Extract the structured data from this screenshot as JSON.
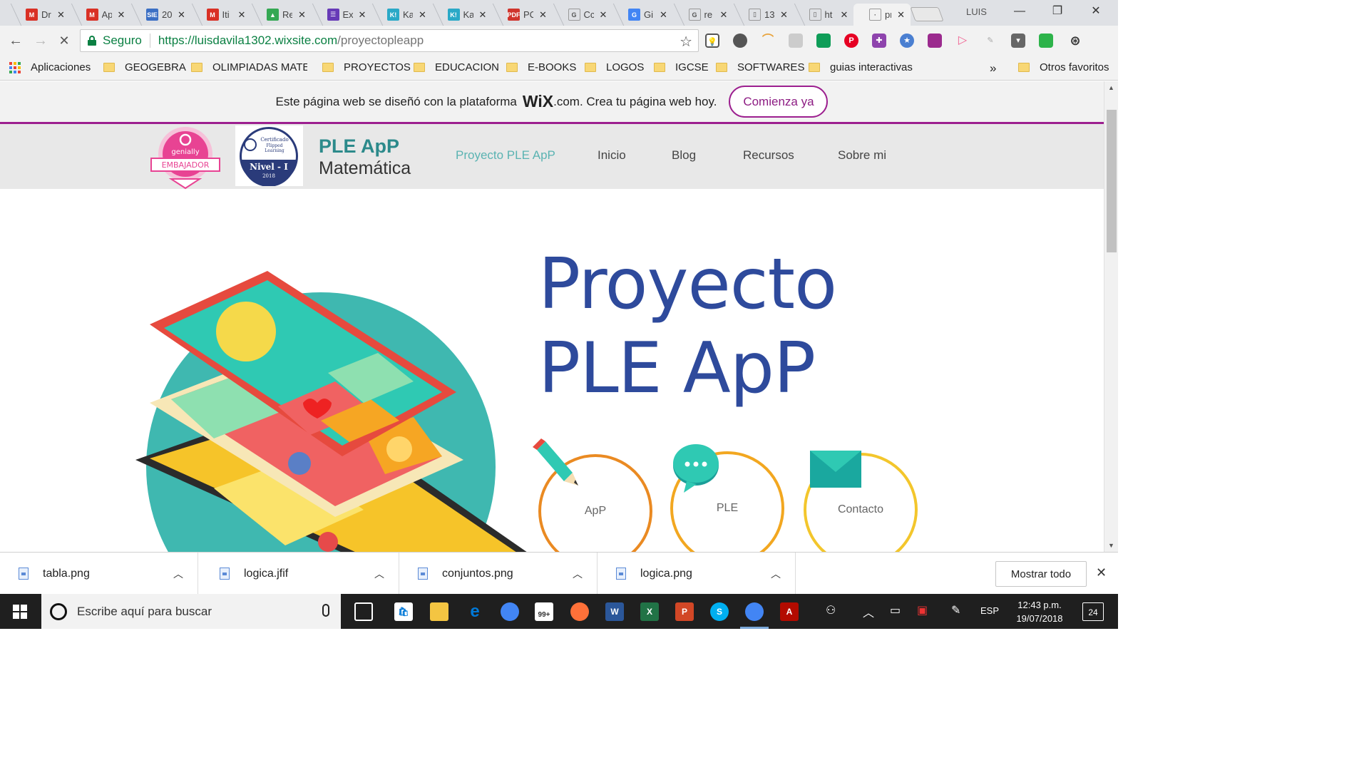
{
  "browser": {
    "tabs": [
      {
        "title": "Dr",
        "icon": "gmail-icon",
        "color": "#d93025",
        "glyph": "M"
      },
      {
        "title": "Ap",
        "icon": "gmail-icon",
        "color": "#d93025",
        "glyph": "M"
      },
      {
        "title": "20",
        "icon": "sie-icon",
        "color": "#3b6fc4",
        "glyph": "SIE"
      },
      {
        "title": "Iti",
        "icon": "gmail-icon",
        "color": "#d93025",
        "glyph": "M"
      },
      {
        "title": "Re",
        "icon": "drive-icon",
        "color": "#34a853",
        "glyph": "▲"
      },
      {
        "title": "Ex",
        "icon": "forms-icon",
        "color": "#673ab7",
        "glyph": "☰"
      },
      {
        "title": "Ka",
        "icon": "kahoot-icon",
        "color": "#2aa9c7",
        "glyph": "K!"
      },
      {
        "title": "Ka",
        "icon": "kahoot-icon",
        "color": "#2aa9c7",
        "glyph": "K!"
      },
      {
        "title": "PC",
        "icon": "pdf-icon",
        "color": "#d0342c",
        "glyph": "PDF"
      },
      {
        "title": "Cc",
        "icon": "google-icon",
        "color": "#ffffff",
        "glyph": "G"
      },
      {
        "title": "Gi",
        "icon": "translate-icon",
        "color": "#4285f4",
        "glyph": "G"
      },
      {
        "title": "re",
        "icon": "google-icon",
        "color": "#ffffff",
        "glyph": "G"
      },
      {
        "title": "13",
        "icon": "page-icon",
        "color": "#ffffff",
        "glyph": "▯"
      },
      {
        "title": "ht",
        "icon": "page-icon",
        "color": "#ffffff",
        "glyph": "▯"
      },
      {
        "title": "pr",
        "icon": "loading-icon",
        "color": "#ffffff",
        "glyph": "·"
      }
    ],
    "profile": "LUIS",
    "secure_label": "Seguro",
    "url_host": "https://luisdavila1302.wixsite.com",
    "url_path": "/proyectopleapp",
    "bookmarks": [
      {
        "label": "Aplicaciones",
        "kind": "apps"
      },
      {
        "label": "GEOGEBRA",
        "kind": "folder"
      },
      {
        "label": "OLIMPIADAS MATEM",
        "kind": "folder"
      },
      {
        "label": "PROYECTOS",
        "kind": "folder"
      },
      {
        "label": "EDUCACION",
        "kind": "folder"
      },
      {
        "label": "E-BOOKS",
        "kind": "folder"
      },
      {
        "label": "LOGOS",
        "kind": "folder"
      },
      {
        "label": "IGCSE",
        "kind": "folder"
      },
      {
        "label": "SOFTWARES",
        "kind": "folder"
      },
      {
        "label": "guias interactivas",
        "kind": "folder"
      }
    ],
    "bookmarks_more": "»",
    "other_bookmarks": "Otros favoritos"
  },
  "wix_banner": {
    "text_before": "Este página web se diseñó con la plataforma",
    "logo": "WiX",
    "text_after": ".com. Crea tu página web hoy.",
    "cta": "Comienza ya"
  },
  "site": {
    "badge_genially_top": "genially",
    "badge_genially_bottom": "EMBAJADOR",
    "badge_flipped_top": "Certificado Flipped Learning",
    "badge_flipped_level": "Nivel - I",
    "badge_flipped_year": "2018",
    "brand_title": "PLE ApP",
    "brand_subtitle": "Matemática",
    "nav": [
      "Proyecto PLE ApP",
      "Inicio",
      "Blog",
      "Recursos",
      "Sobre mi"
    ],
    "hero_line1": "Proyecto",
    "hero_line2": "PLE ApP",
    "circles": [
      "ApP",
      "PLE",
      "Contacto"
    ]
  },
  "downloads": {
    "files": [
      "tabla.png",
      "logica.jfif",
      "conjuntos.png",
      "logica.png"
    ],
    "show_all": "Mostrar todo"
  },
  "taskbar": {
    "search_placeholder": "Escribe aquí para buscar",
    "mail_badge": "99+",
    "language": "ESP",
    "time": "12:43 p.m.",
    "date": "19/07/2018",
    "notifications": "24",
    "colors": {
      "word": "#2b579a",
      "excel": "#217346",
      "powerpoint": "#d24726",
      "skype": "#00aff0",
      "acrobat": "#b30b00",
      "edge": "#0078d7",
      "firefox": "#ff7139"
    }
  }
}
